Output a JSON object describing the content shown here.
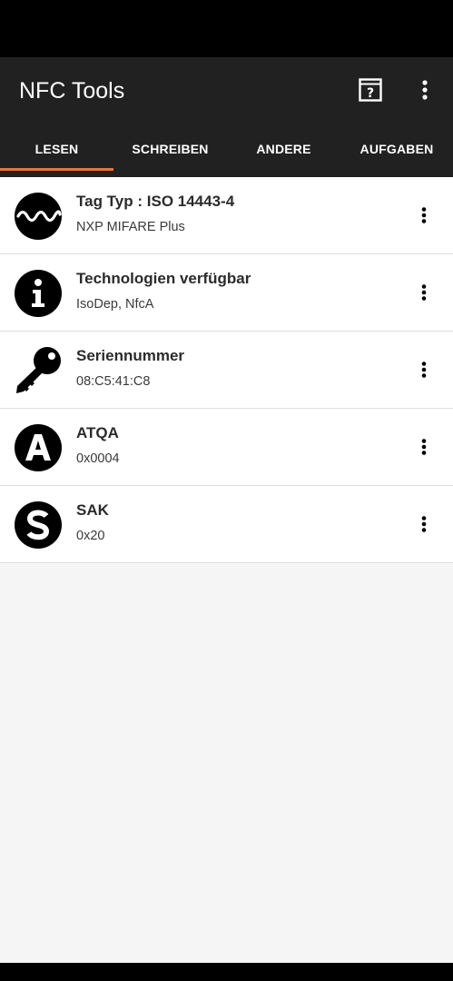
{
  "app": {
    "title": "NFC Tools"
  },
  "toolbar": {
    "help_icon": "help-box-icon",
    "overflow_icon": "more-vert-icon"
  },
  "tabs": [
    {
      "label": "LESEN",
      "selected": true
    },
    {
      "label": "SCHREIBEN",
      "selected": false
    },
    {
      "label": "ANDERE",
      "selected": false
    },
    {
      "label": "AUFGABEN",
      "selected": false
    }
  ],
  "accent_color": "#e8743b",
  "items": [
    {
      "icon": "wave-icon",
      "title": "Tag Typ : ISO 14443-4",
      "subtitle": "NXP MIFARE Plus"
    },
    {
      "icon": "info-icon",
      "title": "Technologien verfügbar",
      "subtitle": "IsoDep, NfcA"
    },
    {
      "icon": "key-icon",
      "title": "Seriennummer",
      "subtitle": "08:C5:41:C8"
    },
    {
      "icon": "letter-a-icon",
      "title": "ATQA",
      "subtitle": "0x0004"
    },
    {
      "icon": "letter-s-icon",
      "title": "SAK",
      "subtitle": "0x20"
    }
  ]
}
